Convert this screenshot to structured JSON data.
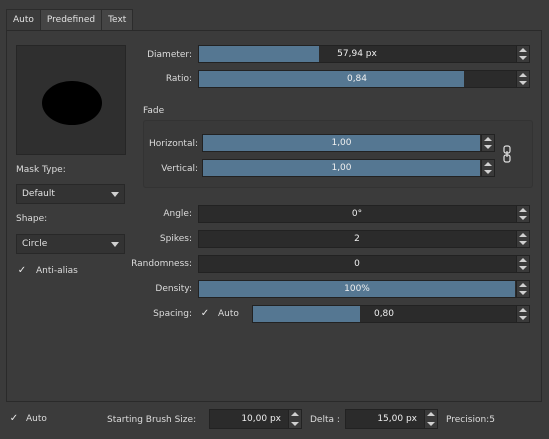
{
  "tabs": [
    "Auto",
    "Predefined",
    "Text"
  ],
  "left": {
    "mask_type_label": "Mask Type:",
    "mask_type_value": "Default",
    "shape_label": "Shape:",
    "shape_value": "Circle",
    "antialias_label": "Anti-alias",
    "antialias_checked": true
  },
  "sliders": {
    "diameter": {
      "label": "Diameter:",
      "value": "57,94 px",
      "fraction": 0.38
    },
    "ratio": {
      "label": "Ratio:",
      "value": "0,84",
      "fraction": 0.84
    }
  },
  "fade": {
    "title": "Fade",
    "horizontal": {
      "label": "Horizontal:",
      "value": "1,00",
      "fraction": 1.0
    },
    "vertical": {
      "label": "Vertical:",
      "value": "1,00",
      "fraction": 1.0
    }
  },
  "params": {
    "angle": {
      "label": "Angle:",
      "value": "0°",
      "fraction": 0.0
    },
    "spikes": {
      "label": "Spikes:",
      "value": "2",
      "fraction": 0.0
    },
    "randomness": {
      "label": "Randomness:",
      "value": "0",
      "fraction": 0.0
    },
    "density": {
      "label": "Density:",
      "value": "100%",
      "fraction": 1.0
    },
    "spacing": {
      "label": "Spacing:",
      "auto_label": "Auto",
      "auto_checked": true,
      "value": "0,80",
      "fraction": 0.41
    }
  },
  "bottom": {
    "auto_label": "Auto",
    "auto_checked": true,
    "start_size_label": "Starting Brush Size:",
    "start_size_value": "10,00 px",
    "delta_label": "Delta :",
    "delta_value": "15,00 px",
    "precision_text": "Precision:5"
  },
  "icons": {
    "checkmark": "check-icon",
    "chain": "chain-link-icon"
  },
  "colors": {
    "accent": "#557792",
    "background": "#3b3b3b"
  }
}
